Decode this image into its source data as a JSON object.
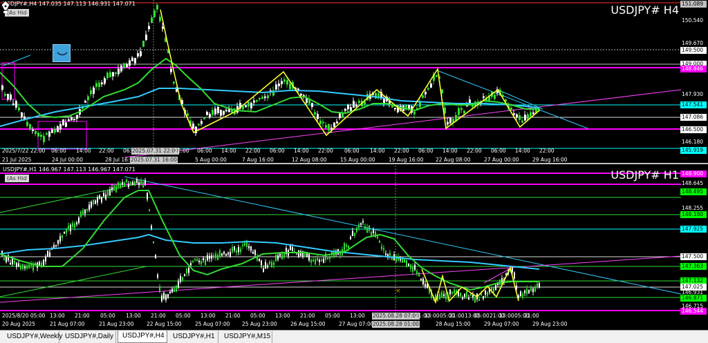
{
  "h4": {
    "info": "USDJPY#,H4  147.035 147.113 146.931 147.071",
    "as_hidden": "(As Hid",
    "title": "USDJPY# H4",
    "price_labels": [
      {
        "text": "151.089",
        "bg": "#c0c0c0",
        "fg": "#000"
      },
      {
        "text": "150.540",
        "bg": "",
        "fg": "#fff"
      },
      {
        "text": "149.670",
        "bg": "",
        "fg": "#fff"
      },
      {
        "text": "149.500",
        "bg": "#ffffff",
        "fg": "#000"
      },
      {
        "text": "149.000",
        "bg": "#ffffff",
        "fg": "#000"
      },
      {
        "text": "148.846",
        "bg": "#ff00ff",
        "fg": "#fff"
      },
      {
        "text": "147.930",
        "bg": "",
        "fg": "#fff"
      },
      {
        "text": "147.541",
        "bg": "#00ffff",
        "fg": "#000"
      },
      {
        "text": "147.086",
        "bg": "#ffffff",
        "fg": "#000"
      },
      {
        "text": "146.500",
        "bg": "#ffffff",
        "fg": "#000"
      },
      {
        "text": "146.180",
        "bg": "",
        "fg": "#fff"
      },
      {
        "text": "145.919",
        "bg": "#00ffff",
        "fg": "#000"
      }
    ],
    "top_time_labels": [
      "2025/7/22 22:00",
      "06:00",
      "14:00",
      "22:00",
      "06:",
      "2025.07.31 22:00",
      "22:00",
      "06:00",
      "14:00",
      "22:00",
      "06:00",
      "14:00",
      "22:00",
      "06:00",
      "14:00",
      "22:00",
      "06:00",
      "14:00",
      "22:00",
      "06:00",
      "14:00",
      "22:00"
    ],
    "date_labels": [
      "21 Jul 2025",
      "24 Jul 00:00",
      "28 Jul 16:00",
      "2025.07.31 16:00",
      "5 Aug 00:00",
      "7 Aug 16:00",
      "12 Aug 08:00",
      "15 Aug 00:00",
      "19 Aug 16:00",
      "22 Aug 08:00",
      "27 Aug 00:00",
      "29 Aug 16:00"
    ]
  },
  "h1": {
    "info": "USDJPY#,H1  146.967 147.113 146.967 147.071",
    "as_hidden": "(As Hid",
    "title": "USDJPY# H1",
    "price_labels": [
      {
        "text": "148.900",
        "bg": "#ff00ff",
        "fg": "#fff"
      },
      {
        "text": "148.645",
        "bg": "",
        "fg": "#fff"
      },
      {
        "text": "148.495",
        "bg": "#00ff00",
        "fg": "#000"
      },
      {
        "text": "148.255",
        "bg": "",
        "fg": "#fff"
      },
      {
        "text": "148.180",
        "bg": "#00ff00",
        "fg": "#000"
      },
      {
        "text": "147.925",
        "bg": "#00ffff",
        "fg": "#000"
      },
      {
        "text": "147.500",
        "bg": "#ffffff",
        "fg": "#000"
      },
      {
        "text": "147.363",
        "bg": "#00ff00",
        "fg": "#000"
      },
      {
        "text": "147.132",
        "bg": "#00ff00",
        "fg": "#000"
      },
      {
        "text": "147.025",
        "bg": "#ffffff",
        "fg": "#000"
      },
      {
        "text": "146.931",
        "bg": "",
        "fg": "#fff"
      },
      {
        "text": "146.871",
        "bg": "#00ff00",
        "fg": "#000"
      },
      {
        "text": "146.715",
        "bg": "",
        "fg": "#fff"
      },
      {
        "text": "146.544",
        "bg": "#ff00ff",
        "fg": "#fff"
      }
    ],
    "bottom_labels": [
      "2025/8/20 05:00",
      "13:00",
      "21:00",
      "05:00",
      "13:00",
      "21:00",
      "05:00",
      "13:00",
      "21:00",
      "05:00",
      "13:00",
      "21:00",
      "05:00",
      "13:00",
      "21:00",
      "05:00",
      "13:00",
      "21:00",
      "05:00",
      "13:00",
      "21:00",
      "2025.08.28 07:00",
      "21:00",
      "05:00",
      "13:00",
      "21:00",
      "05:00"
    ],
    "date_labels": [
      "20 Aug 2025",
      "21 Aug 07:00",
      "21 Aug 23:00",
      "22 Aug 15:00",
      "25 Aug 07:00",
      "25 Aug 23:00",
      "26 Aug 15:00",
      "27 Aug 07:00",
      "2025.08.28 01:00",
      "28 Aug 15:00",
      "29 Aug 07:00",
      "29 Aug 23:00"
    ]
  },
  "tabs": [
    "USDJPY#,Weekly",
    "USDJPY#,Daily",
    "USDJPY#,H4",
    "USDJPY#,H1",
    "USDJPY#,M15"
  ],
  "active_tab": "USDJPY#,H4"
}
